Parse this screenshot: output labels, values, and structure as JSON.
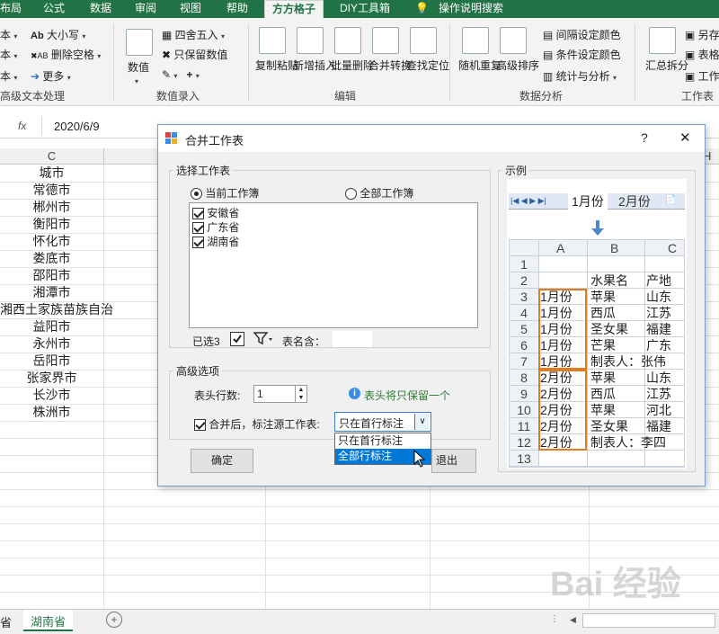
{
  "ribbon": {
    "tabs": [
      "布局",
      "公式",
      "数据",
      "审阅",
      "视图",
      "帮助",
      "方方格子",
      "DIY工具箱",
      "操作说明搜索"
    ],
    "active_tab": "方方格子",
    "text_group": {
      "items": [
        "大小写",
        "删除空格",
        "更多"
      ],
      "label": "高级文本处理"
    },
    "entry_group": {
      "numeric": "数值",
      "round": "四舍五入",
      "keep_value": "只保留数值",
      "label": "数值录入"
    },
    "edit_group": {
      "buttons": [
        "复制粘贴",
        "新增插入",
        "批量删除",
        "合并转换",
        "查找定位"
      ],
      "label": "编辑"
    },
    "analysis_group": {
      "buttons": [
        "随机重复",
        "高级排序"
      ],
      "items": [
        "间隔设定颜色",
        "条件设定颜色",
        "统计与分析"
      ],
      "label": "数据分析"
    },
    "worksheet_group": {
      "buttons": [
        "汇总拆分"
      ],
      "items": [
        "另存",
        "表格",
        "工作"
      ],
      "label": "工作表"
    }
  },
  "formula_bar": {
    "fx": "fx",
    "value": "2020/6/9"
  },
  "sheet": {
    "column_c": "C",
    "column_h": "H",
    "cells": [
      "城市",
      "常德市",
      "郴州市",
      "衡阳市",
      "怀化市",
      "娄底市",
      "邵阳市",
      "湘潭市",
      "湘西土家族苗族自治",
      "益阳市",
      "永州市",
      "岳阳市",
      "张家界市",
      "长沙市",
      "株洲市"
    ],
    "tabs": [
      "省",
      "湖南省"
    ],
    "active_tab": "湖南省"
  },
  "dialog": {
    "title": "合并工作表",
    "help": "?",
    "close": "✕",
    "select_section": {
      "legend": "选择工作表",
      "radio_current": "当前工作簿",
      "radio_all": "全部工作簿",
      "sheets": [
        "安徽省",
        "广东省",
        "湖南省"
      ],
      "selected_count": "已选3",
      "name_contains_label": "表名含：",
      "name_contains_value": ""
    },
    "advanced": {
      "legend": "高级选项",
      "header_rows_label": "表头行数:",
      "header_rows_value": "1",
      "hint": "表头将只保留一个",
      "mark_source_label": "合并后，标注源工作表:",
      "dropdown_value": "只在首行标注",
      "options": [
        "只在首行标注",
        "全部行标注"
      ],
      "highlighted_option": "全部行标注"
    },
    "ok": "确定",
    "exit": "退出",
    "example": {
      "legend": "示例",
      "sheet_tabs": [
        "1月份",
        "2月份"
      ],
      "cols": [
        "A",
        "B",
        "C"
      ],
      "header_b": "水果名",
      "header_c": "产地",
      "rows": [
        {
          "n": "1",
          "a": "",
          "b": "",
          "c": ""
        },
        {
          "n": "2",
          "a": "",
          "b": "水果名",
          "c": "产地"
        },
        {
          "n": "3",
          "a": "1月份",
          "b": "苹果",
          "c": "山东"
        },
        {
          "n": "4",
          "a": "1月份",
          "b": "西瓜",
          "c": "江苏"
        },
        {
          "n": "5",
          "a": "1月份",
          "b": "圣女果",
          "c": "福建"
        },
        {
          "n": "6",
          "a": "1月份",
          "b": "芒果",
          "c": "广东"
        },
        {
          "n": "7",
          "a": "1月份",
          "b": "制表人：张伟",
          "c": ""
        },
        {
          "n": "8",
          "a": "2月份",
          "b": "苹果",
          "c": "山东"
        },
        {
          "n": "9",
          "a": "2月份",
          "b": "西瓜",
          "c": "江苏"
        },
        {
          "n": "10",
          "a": "2月份",
          "b": "苹果",
          "c": "河北"
        },
        {
          "n": "11",
          "a": "2月份",
          "b": "圣女果",
          "c": "福建"
        },
        {
          "n": "12",
          "a": "2月份",
          "b": "制表人：李四",
          "c": ""
        },
        {
          "n": "13",
          "a": "",
          "b": "",
          "c": ""
        }
      ]
    }
  },
  "colors": {
    "excel_green": "#217346",
    "highlight": "#0078d7",
    "orange": "#e07b20",
    "arrow": "#4a86c8"
  }
}
